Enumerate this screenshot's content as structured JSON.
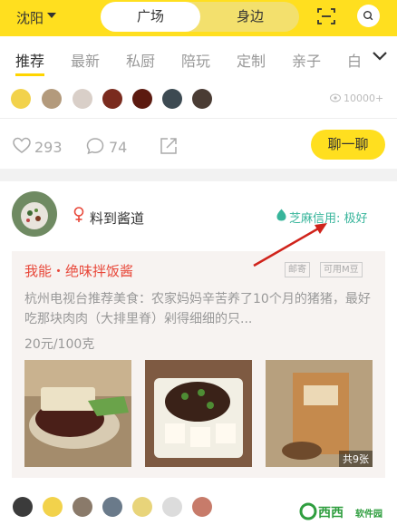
{
  "header": {
    "city": "沈阳",
    "tabs": [
      {
        "label": "广场"
      },
      {
        "label": "身边"
      }
    ],
    "active_tab": "广场"
  },
  "categories": {
    "items": [
      "推荐",
      "最新",
      "私厨",
      "陪玩",
      "定制",
      "亲子",
      "白"
    ],
    "active": "推荐"
  },
  "card1": {
    "view_count": "10000+",
    "likes": "293",
    "comments": "74",
    "chat_button": "聊一聊"
  },
  "card2": {
    "username": "料到酱道",
    "credit": "芝麻信用: 极好",
    "post": {
      "title": "我能・绝味拌饭酱",
      "tags": [
        "邮寄",
        "可用M豆"
      ],
      "description": "杭州电视台推荐美食：农家妈妈辛苦养了10个月的猪猪，最好吃那块肉肉（大排里脊）剁得细细的只...",
      "price": "20元/100克",
      "photo_count": "共9张"
    }
  },
  "watermark": {
    "brand": "西西",
    "sub": "软件园"
  },
  "colors": {
    "brand_yellow": "#ffdf1f",
    "accent_red": "#e8483a",
    "credit_green": "#37b59b"
  }
}
